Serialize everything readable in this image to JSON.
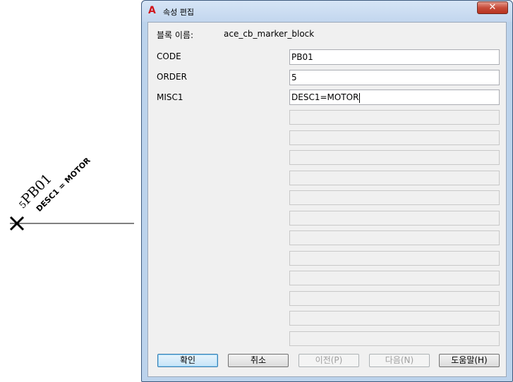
{
  "drawing": {
    "marker_code": "PB01",
    "marker_order": "5",
    "marker_desc": "DESC1 = MOTOR"
  },
  "dialog": {
    "title": "속성 편집",
    "app_icon": "autocad-a-icon",
    "close_glyph": "✕",
    "block_name_label": "블록 이름:",
    "block_name_value": "ace_cb_marker_block",
    "attributes": [
      {
        "tag": "CODE",
        "value": "PB01"
      },
      {
        "tag": "ORDER",
        "value": "5"
      },
      {
        "tag": "MISC1",
        "value": "DESC1=MOTOR"
      }
    ],
    "empty_field_count": 12,
    "buttons": {
      "ok": "확인",
      "cancel": "취소",
      "prev": "이전(P)",
      "next": "다음(N)",
      "help": "도움말(H)"
    }
  }
}
